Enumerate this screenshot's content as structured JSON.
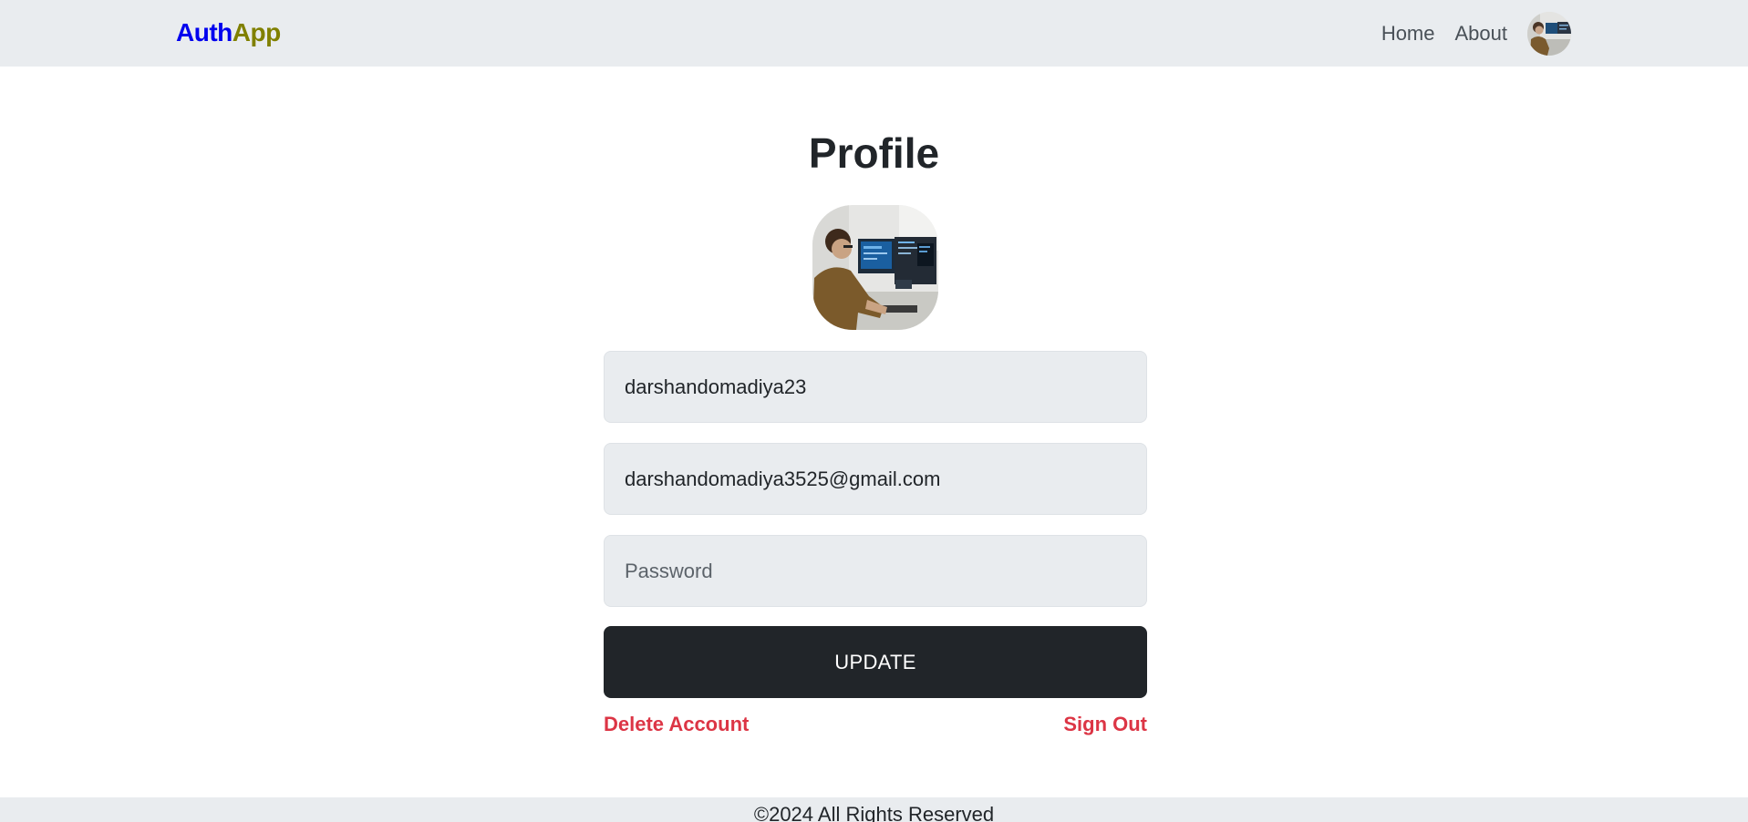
{
  "navbar": {
    "brand_part1": "Auth",
    "brand_part2": "App",
    "links": [
      {
        "label": "Home"
      },
      {
        "label": "About"
      }
    ],
    "avatar_icon": "user-avatar-icon"
  },
  "profile": {
    "title": "Profile",
    "photo_icon": "profile-photo-icon",
    "username_value": "darshandomadiya23",
    "email_value": "darshandomadiya3525@gmail.com",
    "password_placeholder": "Password",
    "update_label": "UPDATE",
    "delete_label": "Delete Account",
    "signout_label": "Sign Out"
  },
  "footer": {
    "text": "©2024 All Rights Reserved"
  },
  "colors": {
    "navbar_bg": "#e9ecef",
    "brand_primary": "#0000ee",
    "brand_secondary": "#808000",
    "button_bg": "#212529",
    "danger": "#dc3545"
  }
}
